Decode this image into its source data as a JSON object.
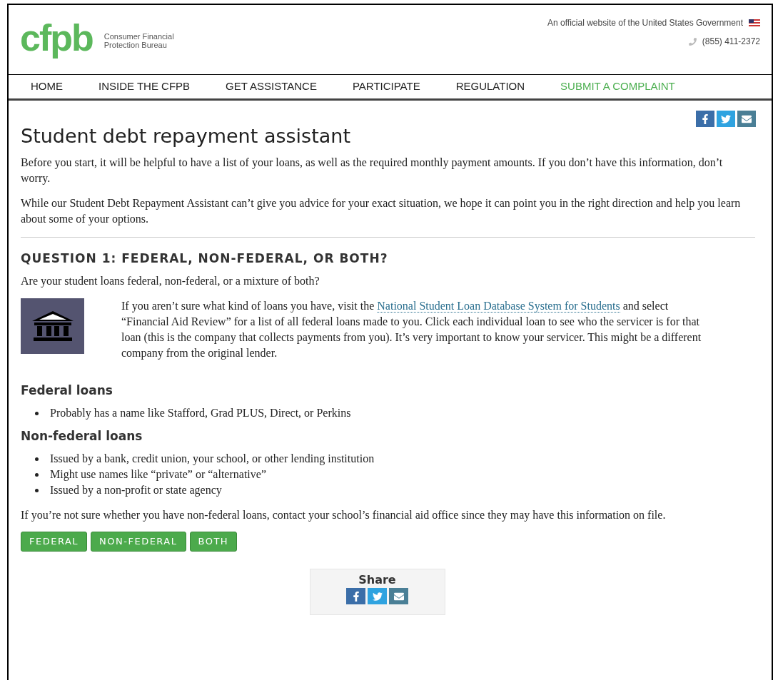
{
  "header": {
    "logo": "cfpb",
    "agency_line_1": "Consumer Financial",
    "agency_line_2": "Protection Bureau",
    "official_notice": "An official website of the United States Government",
    "phone": "(855) 411-2372"
  },
  "nav": [
    {
      "label": "HOME",
      "kind": "plain"
    },
    {
      "label": "INSIDE THE CFPB",
      "kind": "plain"
    },
    {
      "label": "GET ASSISTANCE",
      "kind": "plain"
    },
    {
      "label": "PARTICIPATE",
      "kind": "plain"
    },
    {
      "label": "REGULATION",
      "kind": "plain"
    },
    {
      "label": "SUBMIT A COMPLAINT",
      "kind": "highlight"
    }
  ],
  "title": "Student debt repayment assistant",
  "intro": [
    "Before you start, it will be helpful to have a list of your loans, as well as the required monthly payment amounts. If you don’t have this information, don’t worry.",
    "While our Student Debt Repayment Assistant can’t give you advice for your exact situation, we hope it can point you in the right direction and help you learn about some of your options."
  ],
  "question": {
    "heading": "QUESTION 1: FEDERAL, NON-FEDERAL, OR BOTH?",
    "prompt": "Are your student loans federal, non-federal, or a mixture of both?",
    "info_before": "If you aren’t sure what kind of loans you have, visit the ",
    "info_link": "National Student Loan Database System for Students",
    "info_after": " and select “Financial Aid Review” for a list of all federal loans made to you. Click each individual loan to see who the servicer is for that loan (this is the company that collects payments from you). It’s very important to know your servicer. This might be a different company from the original lender."
  },
  "sections": [
    {
      "heading": "Federal loans",
      "bullets": [
        "Probably has a name like Stafford, Grad PLUS, Direct, or Perkins"
      ]
    },
    {
      "heading": "Non-federal loans",
      "bullets": [
        "Issued by a bank, credit union, your school, or other lending institution",
        "Might use names like “private” or “alternative”",
        "Issued by a non-profit or state agency"
      ]
    }
  ],
  "note": "If you’re not sure whether you have non-federal loans, contact your school’s financial aid office since they may have this information on file.",
  "answers": [
    "FEDERAL",
    "NON-FEDERAL",
    "BOTH"
  ],
  "share": {
    "label": "Share"
  }
}
